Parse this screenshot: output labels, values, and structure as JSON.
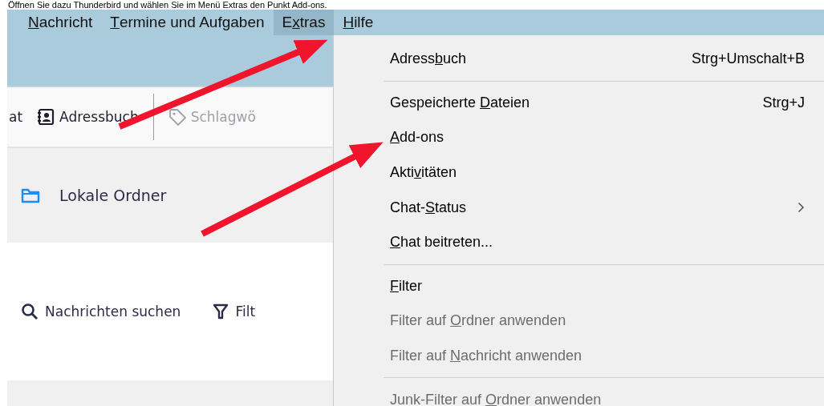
{
  "caption": "Öffnen Sie dazu Thunderbird und wählen Sie im Menü Extras den Punkt Add-ons.",
  "menubar": [
    {
      "key": "N",
      "after": "achricht",
      "selected": false
    },
    {
      "key": "T",
      "after": "ermine und Aufgaben",
      "selected": false
    },
    {
      "before": "E",
      "key": "x",
      "after": "tras",
      "selected": true
    },
    {
      "key": "H",
      "after": "ilfe",
      "selected": false
    }
  ],
  "toolbar": [
    {
      "kind": "text",
      "label": "at",
      "disabled": false
    },
    {
      "kind": "addressbook",
      "label": "Adressbuch",
      "disabled": false
    },
    {
      "kind": "tag",
      "label": "Schlagwö",
      "disabled": true
    }
  ],
  "folder": {
    "name": "Lokale Ordner"
  },
  "search_bar": [
    {
      "kind": "search",
      "label": "Nachrichten suchen"
    },
    {
      "kind": "filter",
      "label": "Filt"
    }
  ],
  "menu": [
    {
      "kind": "item",
      "before": "Adress",
      "key": "b",
      "after": "uch",
      "shortcut": "Strg+Umschalt+B",
      "disabled": false,
      "submenu": false
    },
    {
      "kind": "separator"
    },
    {
      "kind": "item",
      "before": "Gespeicherte ",
      "key": "D",
      "after": "ateien",
      "shortcut": "Strg+J",
      "disabled": false,
      "submenu": false
    },
    {
      "kind": "item",
      "key": "A",
      "after": "dd-ons",
      "disabled": false,
      "submenu": false
    },
    {
      "kind": "item",
      "before": "Akti",
      "key": "v",
      "after": "itäten",
      "disabled": false,
      "submenu": false
    },
    {
      "kind": "item",
      "before": "Chat-",
      "key": "S",
      "after": "tatus",
      "disabled": false,
      "submenu": true
    },
    {
      "kind": "item",
      "key": "C",
      "after": "hat beitreten...",
      "disabled": false,
      "submenu": false
    },
    {
      "kind": "separator"
    },
    {
      "kind": "item",
      "key": "F",
      "after": "ilter",
      "disabled": false,
      "submenu": false
    },
    {
      "kind": "item",
      "before": "Filter auf ",
      "key": "O",
      "after": "rdner anwenden",
      "disabled": true,
      "submenu": false
    },
    {
      "kind": "item",
      "before": "Filter auf ",
      "key": "N",
      "after": "achricht anwenden",
      "disabled": true,
      "submenu": false
    },
    {
      "kind": "separator"
    },
    {
      "kind": "item",
      "before": "Junk-Filter auf ",
      "key": "O",
      "after": "rdner anwenden",
      "disabled": true,
      "submenu": false
    }
  ]
}
